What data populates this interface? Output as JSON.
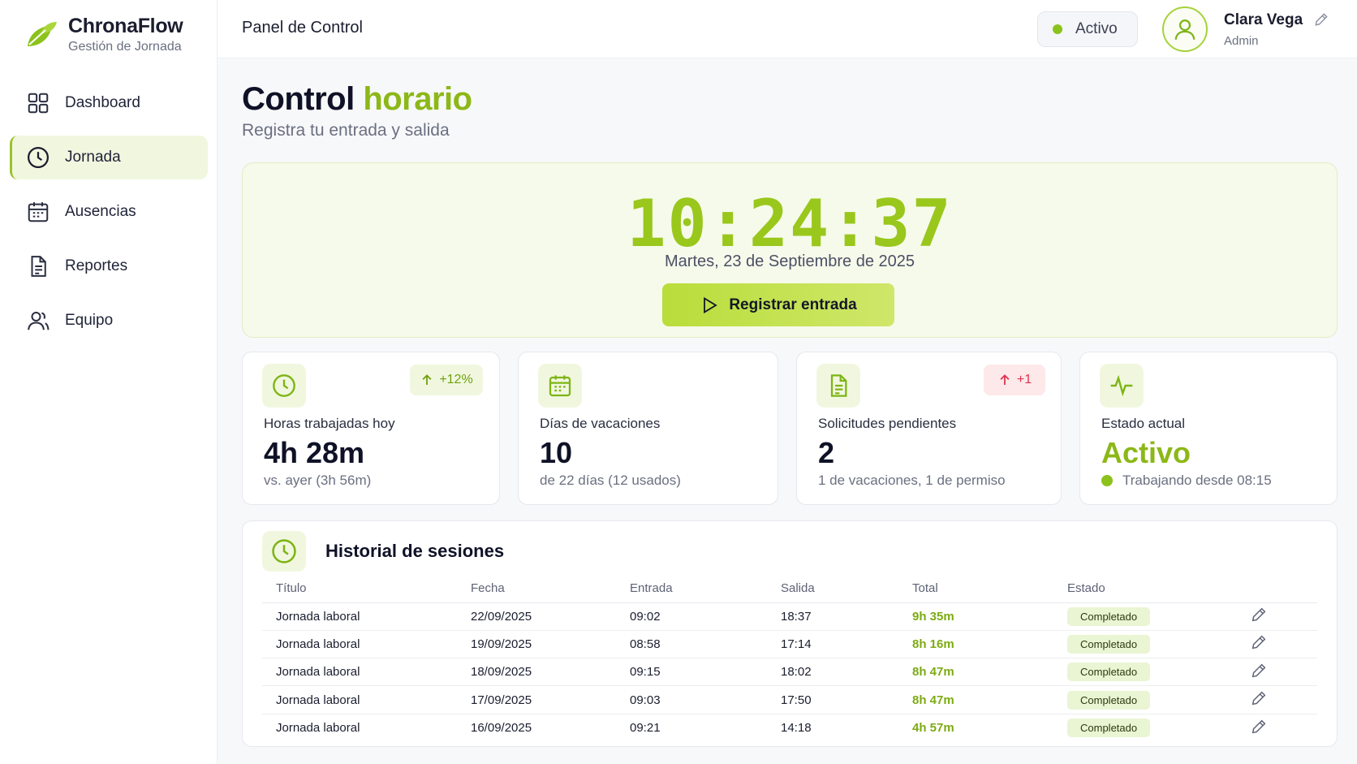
{
  "brand": {
    "name": "ChronaFlow",
    "subtitle": "Gestión de Jornada",
    "accent": "#8cb817"
  },
  "sidebar": {
    "items": [
      {
        "label": "Dashboard",
        "icon": "grid-icon",
        "active": false
      },
      {
        "label": "Jornada",
        "icon": "clock-icon",
        "active": true
      },
      {
        "label": "Ausencias",
        "icon": "calendar-icon",
        "active": false
      },
      {
        "label": "Reportes",
        "icon": "document-icon",
        "active": false
      },
      {
        "label": "Equipo",
        "icon": "users-icon",
        "active": false
      }
    ]
  },
  "header": {
    "title": "Panel de Control",
    "status": "Activo",
    "user_name": "Clara Vega",
    "user_role": "Admin"
  },
  "page": {
    "title_main": "Control",
    "title_accent": "horario",
    "subtitle": "Registra tu entrada y salida"
  },
  "clock": {
    "time": "10:24:37",
    "date": "Martes, 23 de Septiembre de 2025",
    "button_label": "Registrar entrada"
  },
  "stats": [
    {
      "label": "Horas trabajadas hoy",
      "value": "4h 28m",
      "foot": "vs. ayer (3h 56m)",
      "badge": "+12%",
      "icon": "clock-icon"
    },
    {
      "label": "Días de vacaciones",
      "value": "10",
      "foot": "de 22 días (12 usados)",
      "icon": "calendar-icon"
    },
    {
      "label": "Solicitudes pendientes",
      "value": "2",
      "foot": "1 de vacaciones, 1 de permiso",
      "badge": "+1",
      "icon": "document-icon"
    },
    {
      "label": "Estado actual",
      "value": "Activo",
      "foot": "Trabajando desde 08:15",
      "icon": "activity-icon"
    }
  ],
  "history": {
    "title": "Historial de sesiones",
    "columns": [
      "Título",
      "Fecha",
      "Entrada",
      "Salida",
      "Total",
      "Estado"
    ],
    "rows": [
      {
        "title": "Jornada laboral",
        "date": "22/09/2025",
        "in": "09:02",
        "out": "18:37",
        "total": "9h 35m",
        "state": "Completado"
      },
      {
        "title": "Jornada laboral",
        "date": "19/09/2025",
        "in": "08:58",
        "out": "17:14",
        "total": "8h 16m",
        "state": "Completado"
      },
      {
        "title": "Jornada laboral",
        "date": "18/09/2025",
        "in": "09:15",
        "out": "18:02",
        "total": "8h 47m",
        "state": "Completado"
      },
      {
        "title": "Jornada laboral",
        "date": "17/09/2025",
        "in": "09:03",
        "out": "17:50",
        "total": "8h 47m",
        "state": "Completado"
      },
      {
        "title": "Jornada laboral",
        "date": "16/09/2025",
        "in": "09:21",
        "out": "14:18",
        "total": "4h 57m",
        "state": "Completado"
      }
    ]
  }
}
